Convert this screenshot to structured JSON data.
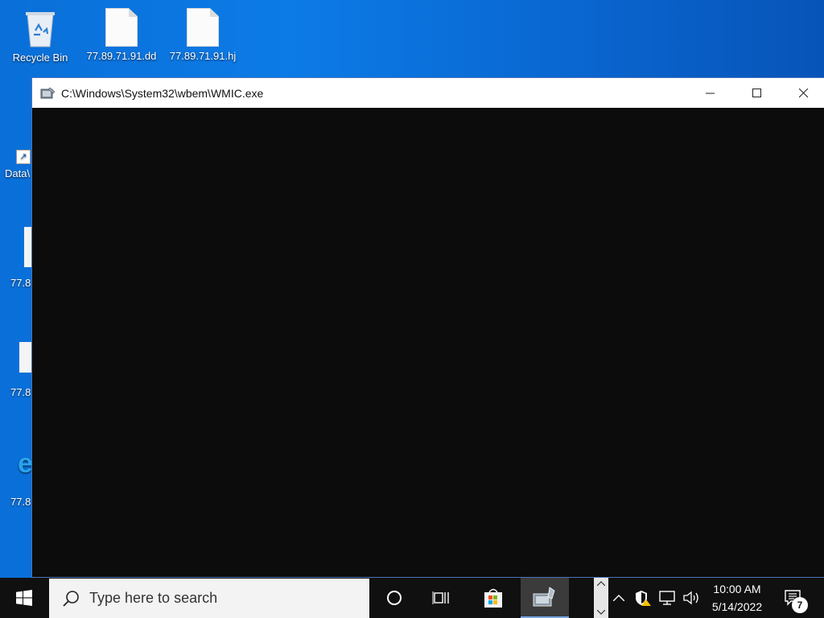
{
  "desktop": {
    "icons": [
      {
        "label": "Recycle Bin"
      },
      {
        "label": "77.89.71.91.dd"
      },
      {
        "label": "77.89.71.91.hj"
      }
    ],
    "partial_icons": [
      {
        "label": "Data\\"
      },
      {
        "label": "77.8"
      },
      {
        "label": "77.8"
      },
      {
        "label": "77.8"
      }
    ]
  },
  "window": {
    "title": "C:\\Windows\\System32\\wbem\\WMIC.exe"
  },
  "taskbar": {
    "search_placeholder": "Type here to search",
    "time": "10:00 AM",
    "date": "5/14/2022",
    "notification_count": "7"
  },
  "colors": {
    "desktop": "#0a6fd8",
    "console": "#0c0c0c",
    "taskbar": "#101010"
  }
}
